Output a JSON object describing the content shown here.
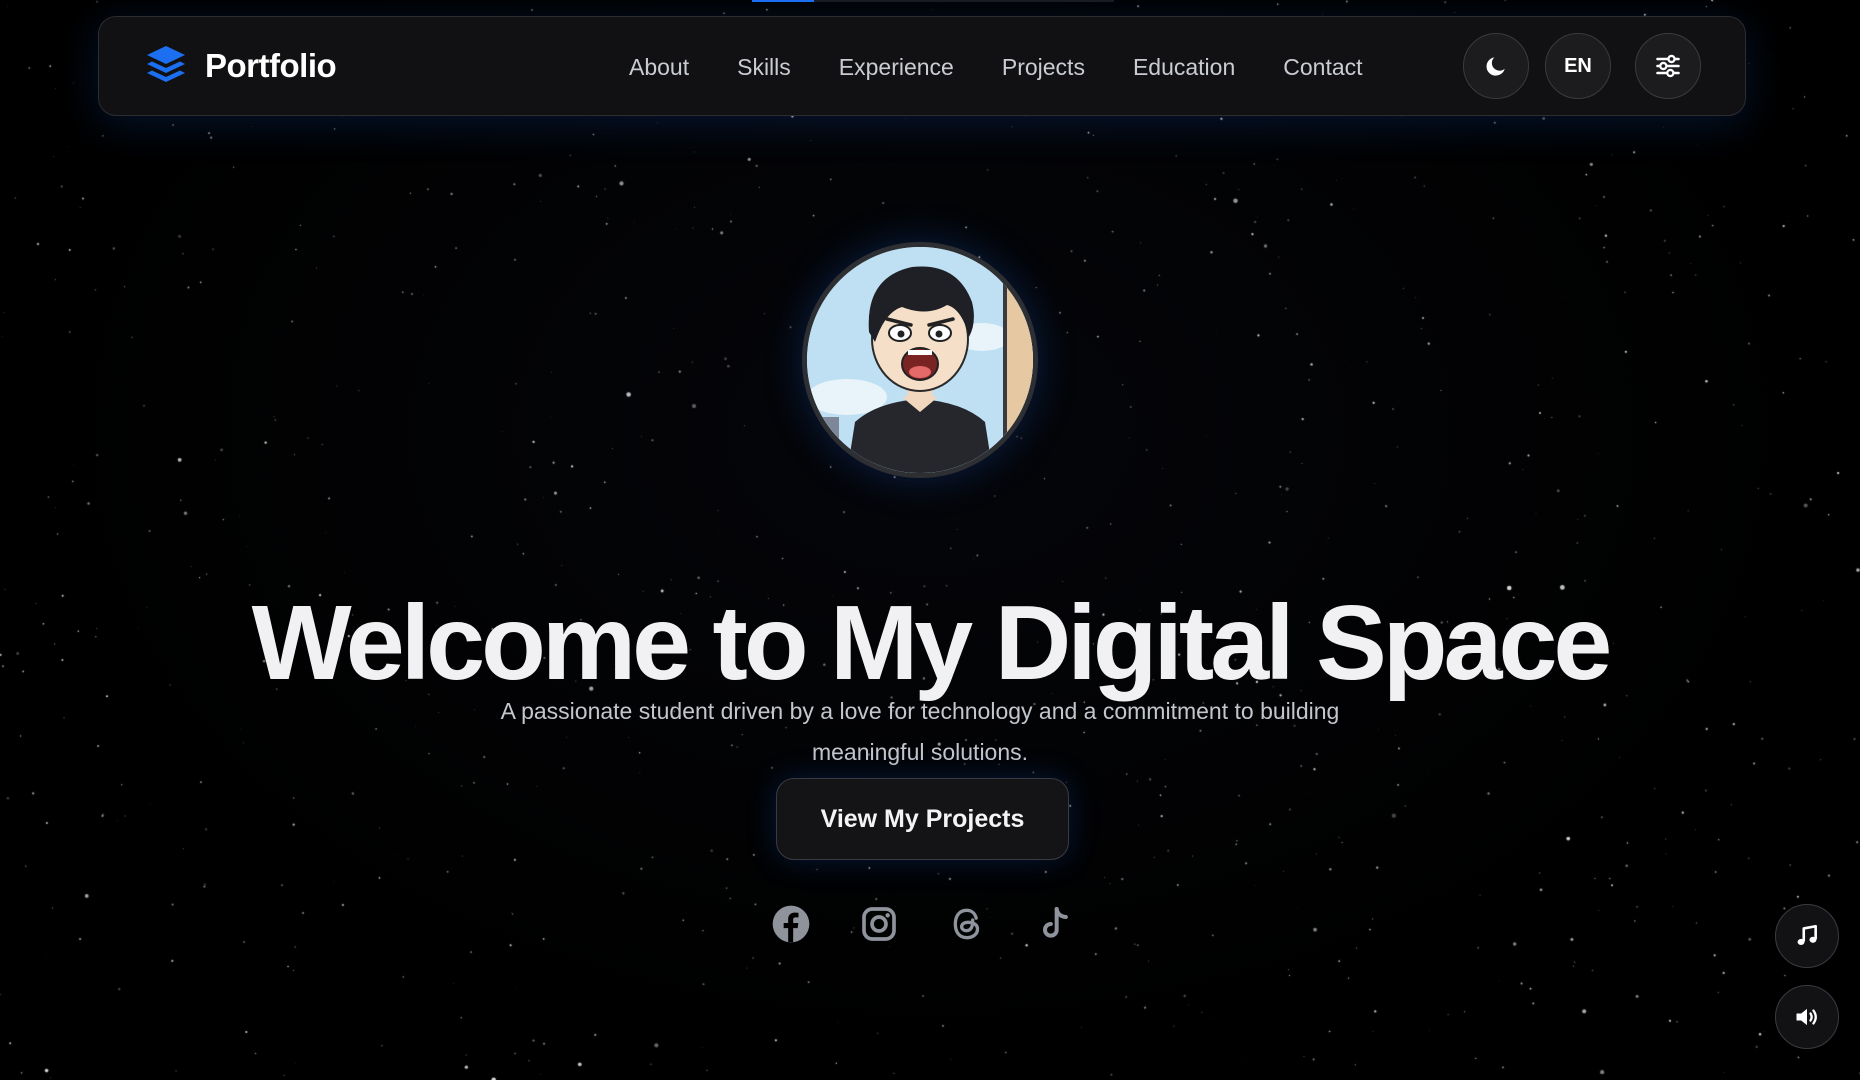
{
  "scroll_progress": 0.17,
  "brand": {
    "name": "Portfolio",
    "icon": "layers-icon",
    "accent_color": "#1d6ff2"
  },
  "nav": {
    "links": [
      {
        "label": "About"
      },
      {
        "label": "Skills"
      },
      {
        "label": "Experience"
      },
      {
        "label": "Projects"
      },
      {
        "label": "Education"
      },
      {
        "label": "Contact"
      }
    ]
  },
  "actions": {
    "theme_icon": "moon-icon",
    "language": "EN",
    "settings_icon": "sliders-icon"
  },
  "hero": {
    "avatar_icon": "cartoon-avatar",
    "title": "Welcome to My Digital Space",
    "subtitle": "A passionate student driven by a love for technology and a commitment to building meaningful solutions.",
    "cta_label": "View My Projects"
  },
  "socials": [
    {
      "icon": "facebook-icon"
    },
    {
      "icon": "instagram-icon"
    },
    {
      "icon": "threads-icon"
    },
    {
      "icon": "tiktok-icon"
    }
  ],
  "floating": {
    "music_icon": "music-note-icon",
    "sound_icon": "volume-icon"
  },
  "colors": {
    "background": "#000000",
    "surface": "#111113",
    "text": "#f1f1f4",
    "muted_text": "#c3c6cd"
  }
}
